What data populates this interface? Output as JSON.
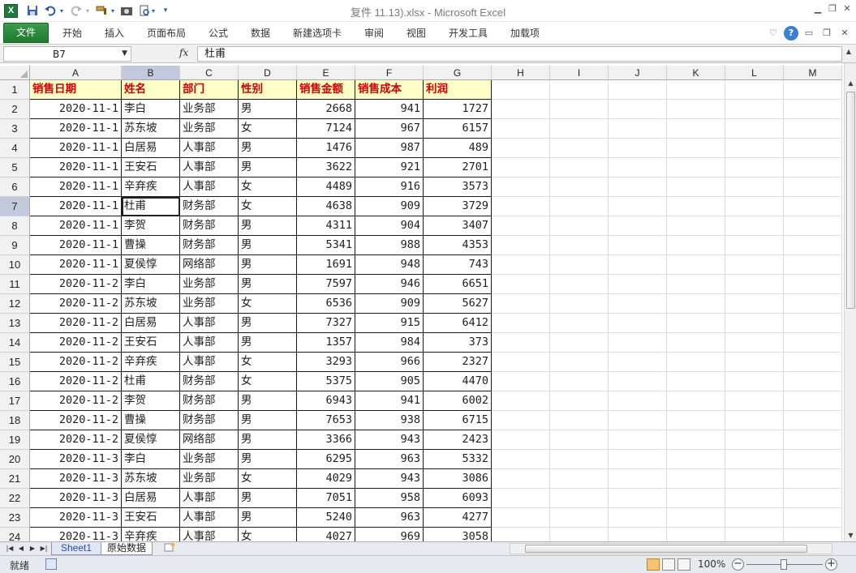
{
  "window": {
    "title": "复件 11.13).xlsx  -  Microsoft Excel"
  },
  "ribbon": {
    "tabs": [
      "文件",
      "开始",
      "插入",
      "页面布局",
      "公式",
      "数据",
      "新建选项卡",
      "审阅",
      "视图",
      "开发工具",
      "加载项"
    ]
  },
  "formula_bar": {
    "cell_ref": "B7",
    "fx": "fx",
    "content": "杜甫"
  },
  "grid": {
    "columns": [
      "A",
      "B",
      "C",
      "D",
      "E",
      "F",
      "G",
      "H",
      "I",
      "J",
      "K",
      "L",
      "M"
    ],
    "selected_column": "B",
    "selected_row": 7,
    "headers": [
      "销售日期",
      "姓名",
      "部门",
      "性别",
      "销售金额",
      "销售成本",
      "利润"
    ],
    "rows": [
      [
        "2020-11-1",
        "李白",
        "业务部",
        "男",
        "2668",
        "941",
        "1727"
      ],
      [
        "2020-11-1",
        "苏东坡",
        "业务部",
        "女",
        "7124",
        "967",
        "6157"
      ],
      [
        "2020-11-1",
        "白居易",
        "人事部",
        "男",
        "1476",
        "987",
        "489"
      ],
      [
        "2020-11-1",
        "王安石",
        "人事部",
        "男",
        "3622",
        "921",
        "2701"
      ],
      [
        "2020-11-1",
        "辛弃疾",
        "人事部",
        "女",
        "4489",
        "916",
        "3573"
      ],
      [
        "2020-11-1",
        "杜甫",
        "财务部",
        "女",
        "4638",
        "909",
        "3729"
      ],
      [
        "2020-11-1",
        "李贺",
        "财务部",
        "男",
        "4311",
        "904",
        "3407"
      ],
      [
        "2020-11-1",
        "曹操",
        "财务部",
        "男",
        "5341",
        "988",
        "4353"
      ],
      [
        "2020-11-1",
        "夏侯惇",
        "网络部",
        "男",
        "1691",
        "948",
        "743"
      ],
      [
        "2020-11-2",
        "李白",
        "业务部",
        "男",
        "7597",
        "946",
        "6651"
      ],
      [
        "2020-11-2",
        "苏东坡",
        "业务部",
        "女",
        "6536",
        "909",
        "5627"
      ],
      [
        "2020-11-2",
        "白居易",
        "人事部",
        "男",
        "7327",
        "915",
        "6412"
      ],
      [
        "2020-11-2",
        "王安石",
        "人事部",
        "男",
        "1357",
        "984",
        "373"
      ],
      [
        "2020-11-2",
        "辛弃疾",
        "人事部",
        "女",
        "3293",
        "966",
        "2327"
      ],
      [
        "2020-11-2",
        "杜甫",
        "财务部",
        "女",
        "5375",
        "905",
        "4470"
      ],
      [
        "2020-11-2",
        "李贺",
        "财务部",
        "男",
        "6943",
        "941",
        "6002"
      ],
      [
        "2020-11-2",
        "曹操",
        "财务部",
        "男",
        "7653",
        "938",
        "6715"
      ],
      [
        "2020-11-2",
        "夏侯惇",
        "网络部",
        "男",
        "3366",
        "943",
        "2423"
      ],
      [
        "2020-11-3",
        "李白",
        "业务部",
        "男",
        "6295",
        "963",
        "5332"
      ],
      [
        "2020-11-3",
        "苏东坡",
        "业务部",
        "女",
        "4029",
        "943",
        "3086"
      ],
      [
        "2020-11-3",
        "白居易",
        "人事部",
        "男",
        "7051",
        "958",
        "6093"
      ],
      [
        "2020-11-3",
        "王安石",
        "人事部",
        "男",
        "5240",
        "963",
        "4277"
      ],
      [
        "2020-11-3",
        "辛弃疾",
        "人事部",
        "女",
        "4027",
        "969",
        "3058"
      ]
    ]
  },
  "sheets": {
    "tabs": [
      "Sheet1",
      "原始数据"
    ],
    "active": "原始数据"
  },
  "status": {
    "text": "就绪",
    "zoom": "100%",
    "zoom_level_percent": 100
  },
  "colors": {
    "header_fill": "#ffffc8",
    "header_text": "#d40000",
    "file_tab": "#1d7a2e",
    "selection": "#c3c9dd"
  },
  "icons": [
    "excel-logo-icon",
    "save-icon",
    "undo-icon",
    "redo-icon",
    "format-painter-icon",
    "camera-icon",
    "print-preview-icon",
    "customize-qat-icon",
    "help-icon"
  ]
}
